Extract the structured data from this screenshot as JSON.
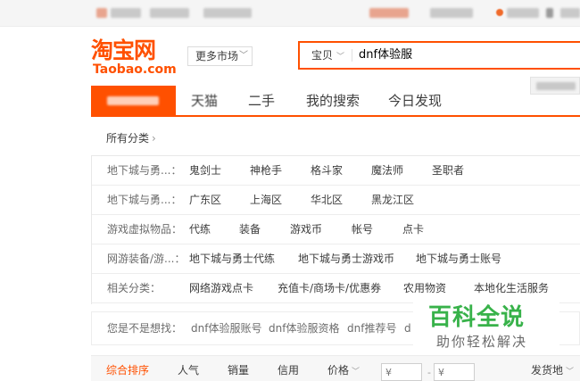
{
  "header": {
    "logo_cn": "淘宝网",
    "logo_en": "Taobao.com",
    "market_button": "更多市场",
    "search_type": "宝贝",
    "search_value": "dnf体验服"
  },
  "nav": {
    "tabs": [
      {
        "label": "天猫"
      },
      {
        "label": "二手"
      },
      {
        "label": "我的搜索"
      },
      {
        "label": "今日发现"
      }
    ]
  },
  "filters": {
    "all_categories": "所有分类",
    "rows": [
      {
        "label": "地下城与勇...：",
        "options": [
          "鬼剑士",
          "神枪手",
          "格斗家",
          "魔法师",
          "圣职者"
        ]
      },
      {
        "label": "地下城与勇...：",
        "options": [
          "广东区",
          "上海区",
          "华北区",
          "黑龙江区"
        ]
      },
      {
        "label": "游戏虚拟物品：",
        "options": [
          "代练",
          "装备",
          "游戏币",
          "帐号",
          "点卡"
        ]
      },
      {
        "label": "网游装备/游...：",
        "options": [
          "地下城与勇士代练",
          "地下城与勇士游戏币",
          "地下城与勇士账号"
        ]
      },
      {
        "label": "相关分类：",
        "options": [
          "网络游戏点卡",
          "充值卡/商场卡/优惠券",
          "农用物资",
          "本地化生活服务"
        ]
      }
    ]
  },
  "suggest": {
    "label": "您是不是想找：",
    "items": [
      "dnf体验服账号",
      "dnf体验服资格",
      "dnf推荐号",
      "d"
    ]
  },
  "sort": {
    "items": [
      "综合排序",
      "人气",
      "销量",
      "信用",
      "价格"
    ],
    "price_min_placeholder": "¥",
    "price_max_placeholder": "¥",
    "ship_from": "发货地"
  },
  "watermark": {
    "title": "百科全说",
    "subtitle": "助你轻松解决"
  },
  "colors": {
    "accent": "#ff5000",
    "watermark_green": "#38b24a"
  }
}
